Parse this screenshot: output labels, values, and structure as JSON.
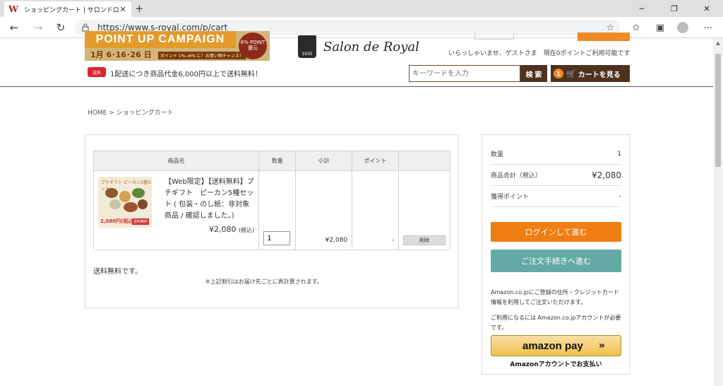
{
  "browser": {
    "tab_title": "ショッピングカート | サロンドロワイヤル",
    "url": "https://www.s-royal.com/p/cart",
    "favicon": "W"
  },
  "header": {
    "campaign_title": "POINT UP CAMPAIGN",
    "campaign_dates": "1月 6･16･26 日",
    "campaign_note": "ポイント 1%→6% に！お買い物チャンス！",
    "campaign_badge": "6% POINT 還元",
    "brand_name": "Salon de Royal",
    "brand_year": "1935",
    "welcome": "いらっしゃいませ、ゲストさま　現在0ポイントご利用可能です",
    "ship_icon_text": "送料",
    "shipping_message": "1配送につき商品代金6,000円以上で送料無料！",
    "search_placeholder": "キーワードを入力",
    "search_button": "検 索",
    "cart_count": "1",
    "cart_button": "カートを見る"
  },
  "breadcrumb": "HOME > ショッピングカート",
  "cart": {
    "columns": [
      "商品名",
      "数量",
      "小計",
      "ポイント",
      ""
    ],
    "item": {
      "name": "【Web限定】【送料無料】プチギフト　ピーカン5種セット ( 包装・のし紙：非対象商品 / 確認しました。)",
      "image_title": "プチギフト ピーカン5種セット",
      "image_price": "2,080円(税込)",
      "image_tag": "送料無料",
      "price": "¥2,080",
      "price_tax": "(税込)",
      "quantity": "1",
      "subtotal": "¥2,080",
      "points": "-",
      "delete_label": "削除"
    },
    "free_shipping": "送料無料です。",
    "recalc_note": "※上記割引はお届け先ごとに再計算されます。"
  },
  "summary": {
    "rows": [
      {
        "label": "数量",
        "value": "1"
      },
      {
        "label": "商品合計（税込）",
        "value": "¥2,080"
      },
      {
        "label": "獲得ポイント",
        "value": "-"
      }
    ],
    "login_button": "ログインして進む",
    "order_button": "ご注文手続きへ進む",
    "amazon_note1": "Amazon.co.jpにご登録の住所・クレジットカード情報を利用してご注文いただけます。",
    "amazon_note2": "ご利用になるには Amazon.co.jpアカウントが必要です。",
    "amazon_button": "amazon pay",
    "amazon_caption": "Amazonアカウントでお支払い"
  }
}
